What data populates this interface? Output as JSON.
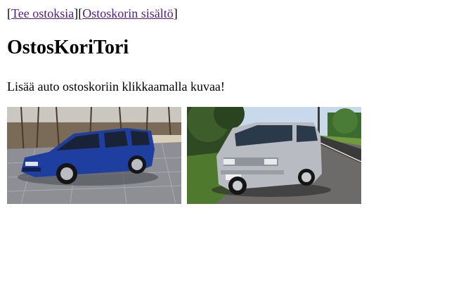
{
  "nav": {
    "open_bracket": "[",
    "mid_bracket": "][",
    "close_bracket": "]",
    "links": [
      {
        "label": "Tee ostoksia"
      },
      {
        "label": "Ostoskorin sisältö"
      }
    ],
    "link_color": "#551a8b"
  },
  "page": {
    "title": "OstosKoriTori",
    "instruction": "Lisää auto ostoskoriin klikkaamalla kuvaa!"
  },
  "gallery": {
    "items": [
      {
        "icon": "blue-station-wagon-photo",
        "color": "#1f3fa0"
      },
      {
        "icon": "silver-van-photo",
        "color": "#b8bcc2"
      }
    ]
  }
}
